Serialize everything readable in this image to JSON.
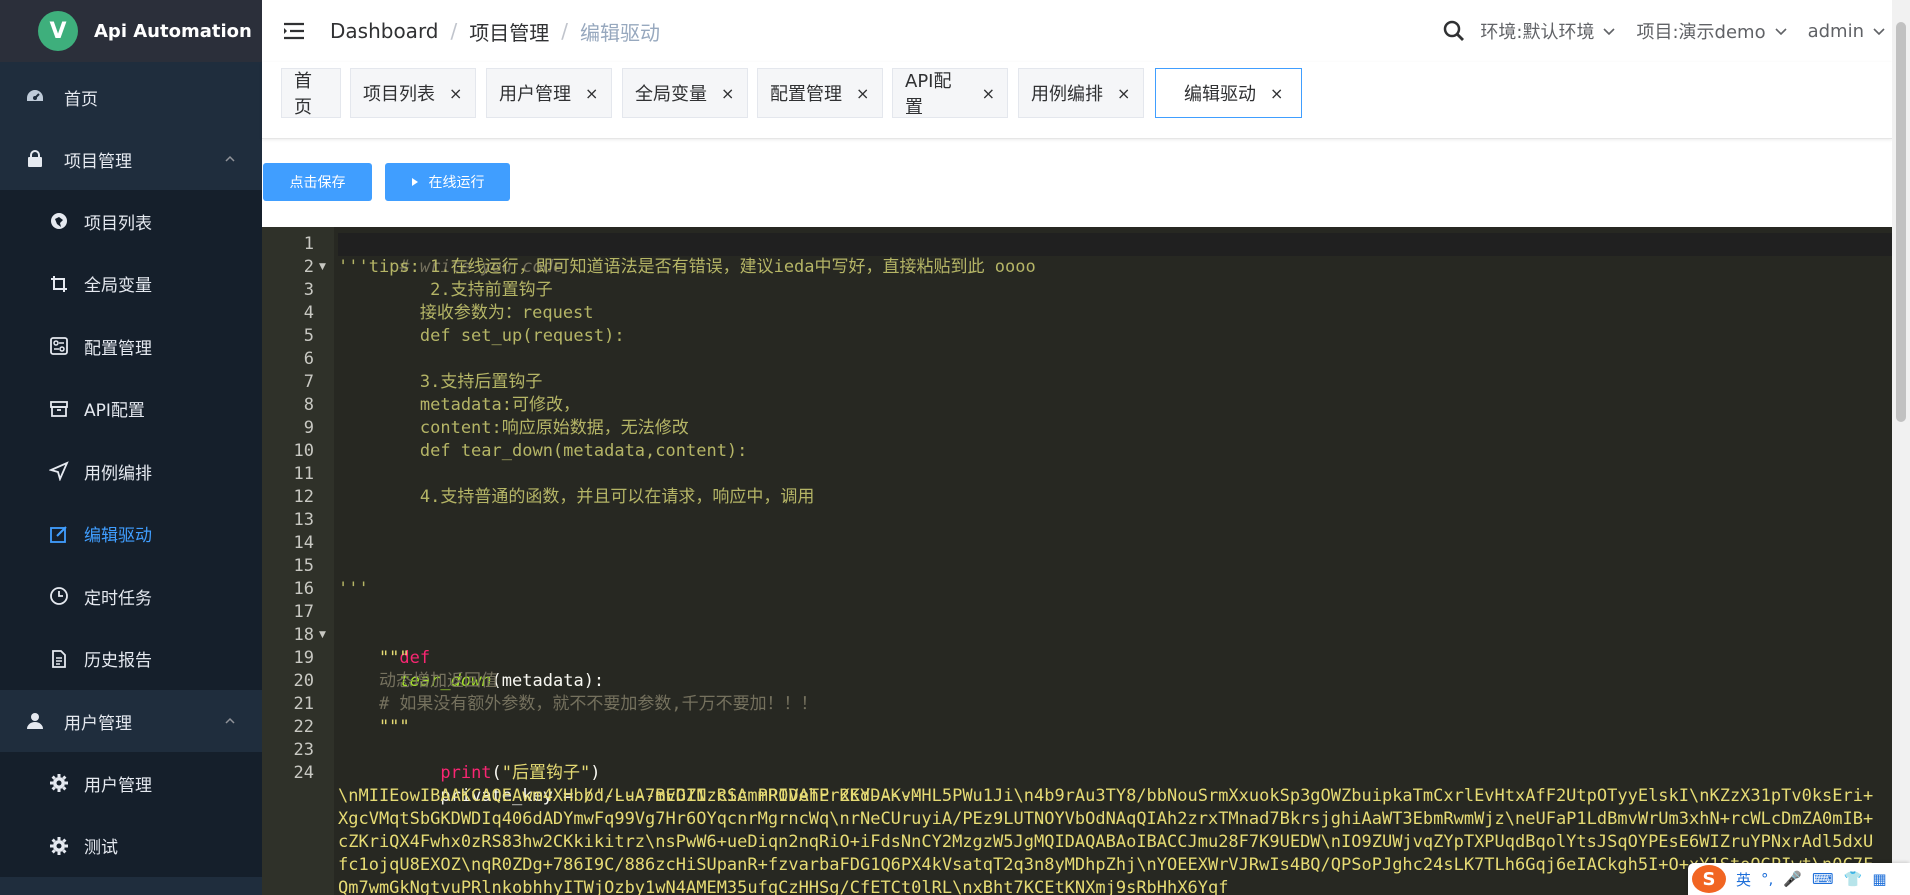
{
  "app": {
    "logo_letter": "V",
    "title": "Api Automation"
  },
  "sidebar": {
    "home": "首页",
    "project_group": "项目管理",
    "project_items": [
      {
        "label": "项目列表",
        "icon": "globe-icon"
      },
      {
        "label": "全局变量",
        "icon": "crop-icon"
      },
      {
        "label": "配置管理",
        "icon": "config-icon"
      },
      {
        "label": "API配置",
        "icon": "box-icon"
      },
      {
        "label": "用例编排",
        "icon": "send-icon"
      },
      {
        "label": "编辑驱动",
        "icon": "edit-icon",
        "active": true
      },
      {
        "label": "定时任务",
        "icon": "clock-icon"
      },
      {
        "label": "历史报告",
        "icon": "document-icon"
      }
    ],
    "user_group": "用户管理",
    "user_items": [
      {
        "label": "用户管理",
        "icon": "gear-icon"
      },
      {
        "label": "测试",
        "icon": "gear-icon"
      }
    ]
  },
  "navbar": {
    "breadcrumb": [
      "Dashboard",
      "项目管理",
      "编辑驱动"
    ],
    "environment": "环境:默认环境",
    "project": "项目:演示demo",
    "user": "admin"
  },
  "tags": [
    {
      "label": "首页",
      "closable": false
    },
    {
      "label": "项目列表",
      "closable": true
    },
    {
      "label": "用户管理",
      "closable": true
    },
    {
      "label": "全局变量",
      "closable": true
    },
    {
      "label": "配置管理",
      "closable": true
    },
    {
      "label": "API配置",
      "closable": true
    },
    {
      "label": "用例编排",
      "closable": true
    },
    {
      "label": "编辑驱动",
      "closable": true,
      "active": true
    }
  ],
  "close_glyph": "×",
  "buttons": {
    "save": "点击保存",
    "run": "在线运行"
  },
  "editor": {
    "line_numbers": [
      "1",
      "2",
      "3",
      "4",
      "5",
      "6",
      "7",
      "8",
      "9",
      "10",
      "11",
      "12",
      "13",
      "14",
      "15",
      "16",
      "17",
      "18",
      "19",
      "20",
      "21",
      "22",
      "23",
      "24"
    ],
    "lines": {
      "l1": "# write you code",
      "l2": "'''tips: 1.在线运行，即可知道语法是否有错误，建议ieda中写好，直接粘贴到此 oooo",
      "l3": "         2.支持前置钩子",
      "l4": "        接收参数为：request",
      "l5": "        def set_up(request):",
      "l7": "        3.支持后置钩子",
      "l8": "        metadata:可修改，",
      "l9": "        content:响应原始数据，无法修改",
      "l10": "        def tear_down(metadata,content):",
      "l12": "        4.支持普通的函数，并且可以在请求，响应中，调用",
      "l16": "'''",
      "l18_kw": "def",
      "l18_fn": "tear_down",
      "l18_open": "(",
      "l18_param": "metadata",
      "l18_close": "):",
      "l19": "    \"\"\"",
      "l20": "    动态增加返回值",
      "l21": "    # 如果没有额外参数，就不不要加参数,千万不要加！！！",
      "l22": "    \"\"\"",
      "l23_fn": "    print",
      "l23_open": "(",
      "l23_str": "\"后置钩子\"",
      "l23_close": ")",
      "l24_var": "    private_key = ",
      "l24_str": "b'-----BEGIN RSA PRIVATE KEY-----",
      "l24_wrap": "\\nMIIEowIBAAKCAQEAwm4XHb/d/LuA7mvDZIzcicmmP0DehPr2KdDAKvMHL5PWu1Ji\\n4b9rAu3TY8/bbNouSrmXxuokSp3gOWZbuipkaTmCxrlEvHtxAfF2UtpOTyyElskI\\nKZzX31pTv0ksEri+XgcVMqtSbGKDWDIq406dADYmwFq99Vg7Hr6OYqcnrMgrncWq\\nrNeCUruyiA/PEz9LUTNOYVbOdNAqQIAh2zrxTMnad7BkrsjghiAaWT3EbmRwmWjz\\neUFaP1LdBmvWrUm3xhN+rcWLcDmZA0mIB+cZKriQX4Fwhx0zRS83hw2CKkikitrz\\nsPwW6+ueDiqn2nqRiO+iFdsNnCY2MzgzW5JgMQIDAQABAoIBACCJmu28F7K9UEDW\\nIO9ZUWjvqZYpTXPUqdBqolYtsJSqOYPEsE6WIZruYPNxrAdl5dxUfc1ojqU8EXOZ\\nqR0ZDg+786I9C/886zcHiSUpanR+fzvarbaFDG1Q6PX4kVsatqT2q3n8yMDhpZhj\\nYOEEXWrVJRwIs4BQ/QPSoPJghc24sLK7TLh6Gqj6eIACkgh5I+O+xY1StoOGPIwt\\n0C7FQm7wmGkNgtvuPRlnkobhhyITWjOzby1wN4AMEM35ufqCzHHSg/CfETCt0lRL\\nxBht7KCEtKNXmj9sRbHhX6Yqf"
    }
  },
  "ime": {
    "logo": "S",
    "lang": "英",
    "items": [
      "°,",
      "🎤",
      "⌨",
      "👕",
      "▦"
    ]
  },
  "colors": {
    "sidebar_bg": "#1f2d3d",
    "accent": "#409eff",
    "editor_bg": "#272822"
  }
}
